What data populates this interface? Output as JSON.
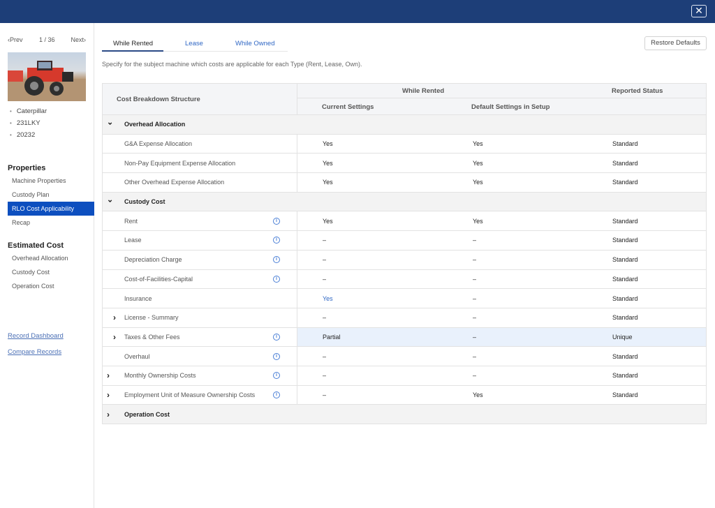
{
  "header": {
    "close_label": "✕"
  },
  "sidebar": {
    "pager": {
      "prev": "‹Prev",
      "count": "1 / 36",
      "next": "Next›"
    },
    "specs": [
      "Caterpillar",
      "231LKY",
      "20232"
    ],
    "properties_title": "Properties",
    "properties_items": [
      "Machine Properties",
      "Custody Plan",
      "RLO Cost Applicability",
      "Recap"
    ],
    "active_item": "RLO Cost Applicability",
    "estimated_title": "Estimated Cost",
    "estimated_items": [
      "Overhead Allocation",
      "Custody Cost",
      "Operation Cost"
    ],
    "links": [
      "Record Dashboard",
      "Compare Records"
    ]
  },
  "tabs": [
    {
      "label": "While Rented",
      "active": true
    },
    {
      "label": "Lease",
      "active": false
    },
    {
      "label": "While Owned",
      "active": false
    }
  ],
  "restore_label": "Restore Defaults",
  "description": "Specify for the subject machine which costs are applicable for each Type (Rent, Lease, Own).",
  "table": {
    "headers": {
      "structure": "Cost Breakdown Structure",
      "group": "While Rented",
      "current": "Current Settings",
      "default": "Default Settings in Setup",
      "status": "Reported Status"
    },
    "rows": [
      {
        "type": "group",
        "name": "Overhead Allocation",
        "chevron": "down"
      },
      {
        "type": "item",
        "name": "G&A Expense Allocation",
        "current": "Yes",
        "default": "Yes",
        "status": "Standard"
      },
      {
        "type": "item",
        "name": "Non-Pay Equipment Expense Allocation",
        "current": "Yes",
        "default": "Yes",
        "status": "Standard"
      },
      {
        "type": "item",
        "name": "Other Overhead Expense Allocation",
        "current": "Yes",
        "default": "Yes",
        "status": "Standard"
      },
      {
        "type": "group",
        "name": "Custody Cost",
        "chevron": "down"
      },
      {
        "type": "item",
        "name": "Rent",
        "info": true,
        "current": "Yes",
        "default": "Yes",
        "status": "Standard"
      },
      {
        "type": "item",
        "name": "Lease",
        "info": true,
        "current": "–",
        "default": "–",
        "status": "Standard"
      },
      {
        "type": "item",
        "name": "Depreciation Charge",
        "info": true,
        "current": "–",
        "default": "–",
        "status": "Standard"
      },
      {
        "type": "item",
        "name": "Cost-of-Facilities-Capital",
        "info": true,
        "current": "–",
        "default": "–",
        "status": "Standard"
      },
      {
        "type": "item",
        "name": "Insurance",
        "current": "Yes",
        "current_link": true,
        "default": "–",
        "status": "Standard"
      },
      {
        "type": "item",
        "name": "License - Summary",
        "chevron": "right-indented",
        "current": "–",
        "default": "–",
        "status": "Standard"
      },
      {
        "type": "item",
        "name": "Taxes & Other Fees",
        "chevron": "right-indented",
        "info": true,
        "current": "Partial",
        "default": "–",
        "status": "Unique",
        "highlight": true
      },
      {
        "type": "item",
        "name": "Overhaul",
        "info": true,
        "current": "–",
        "default": "–",
        "status": "Standard"
      },
      {
        "type": "item",
        "name": "Monthly Ownership Costs",
        "chevron": "right",
        "info": true,
        "current": "–",
        "default": "–",
        "status": "Standard"
      },
      {
        "type": "item",
        "name": "Employment Unit of Measure Ownership Costs",
        "chevron": "right",
        "info": true,
        "current": "–",
        "default": "Yes",
        "status": "Standard"
      },
      {
        "type": "group",
        "name": "Operation Cost",
        "chevron": "right"
      }
    ]
  }
}
